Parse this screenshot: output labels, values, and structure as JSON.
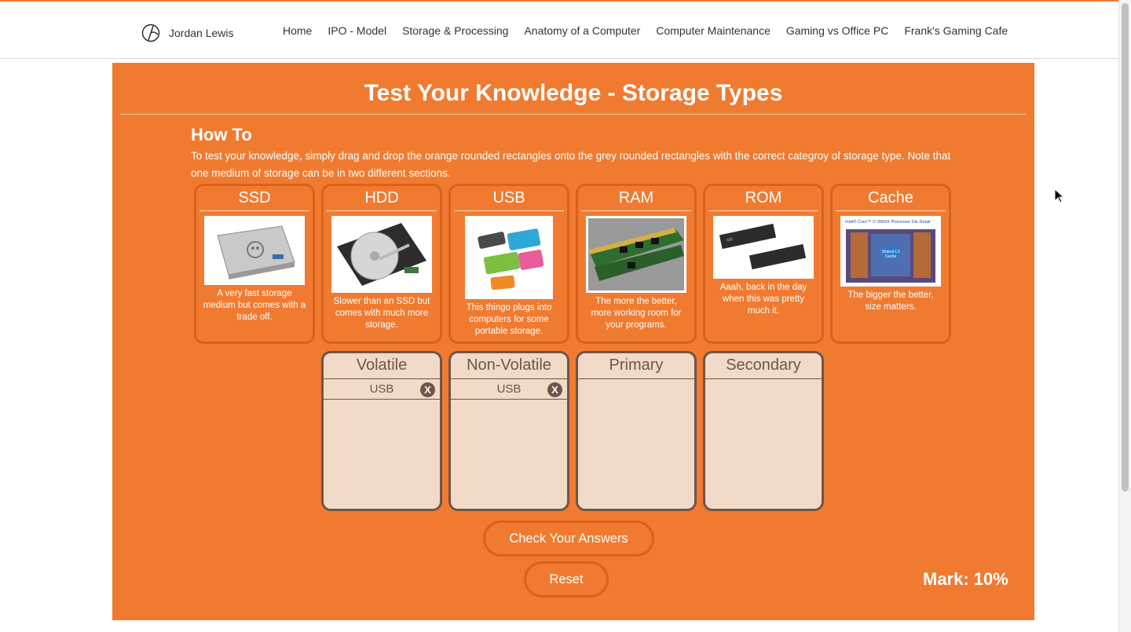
{
  "header": {
    "brand_name": "Jordan Lewis",
    "nav": [
      "Home",
      "IPO - Model",
      "Storage & Processing",
      "Anatomy of a Computer",
      "Computer Maintenance",
      "Gaming vs Office PC",
      "Frank's Gaming Cafe"
    ]
  },
  "main": {
    "title": "Test Your Knowledge - Storage Types",
    "howto_heading": "How To",
    "howto_text": "To test your knowledge, simply drag and drop the orange rounded rectangles onto the grey rounded rectangles with the correct categroy of storage type. Note that one medium of storage can be in two different sections.",
    "cards": [
      {
        "title": "SSD",
        "desc": "A very fast storage medium but comes with a trade off."
      },
      {
        "title": "HDD",
        "desc": "Slower than an SSD but comes with much more storage."
      },
      {
        "title": "USB",
        "desc": "This thingo plugs into computers for some portable storage."
      },
      {
        "title": "RAM",
        "desc": "The more the better, more working room for your programs."
      },
      {
        "title": "ROM",
        "desc": "Aaah, back in the day when this was pretty much it."
      },
      {
        "title": "Cache",
        "desc": "The bigger the better, size matters."
      }
    ],
    "cache_image_caption": "Intel® Core™ i7-3960X Processor Die Detail",
    "cache_image_label": "Shared L3 Cache",
    "zones": [
      {
        "title": "Volatile",
        "items": [
          "USB"
        ]
      },
      {
        "title": "Non-Volatile",
        "items": [
          "USB"
        ]
      },
      {
        "title": "Primary",
        "items": []
      },
      {
        "title": "Secondary",
        "items": []
      }
    ],
    "remove_glyph": "X",
    "check_button": "Check Your Answers",
    "reset_button": "Reset",
    "mark": "Mark: 10%"
  },
  "colors": {
    "accent": "#f07b30",
    "accent_border": "#d9601e",
    "zone_bg": "#f2dac9",
    "zone_border": "#6e5549"
  }
}
